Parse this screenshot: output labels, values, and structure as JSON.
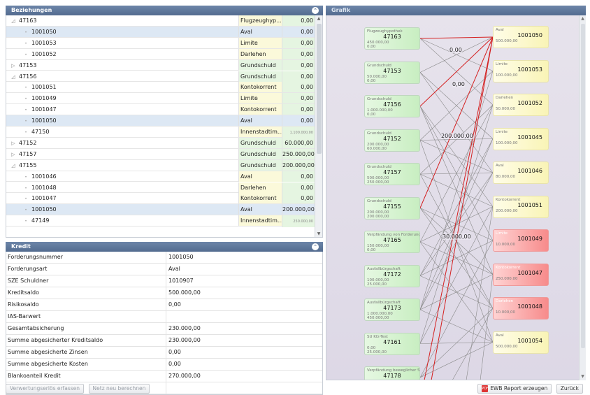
{
  "beziehungen": {
    "title": "Beziehungen",
    "rows": [
      {
        "level": 0,
        "expand": "open",
        "name": "47163",
        "type": "Flugzeughyp...",
        "value": "0,00",
        "tbg": "y",
        "vbg": "g",
        "selected": false
      },
      {
        "level": 1,
        "name": "1001050",
        "type": "Aval",
        "value": "0,00",
        "selected": true
      },
      {
        "level": 1,
        "name": "1001053",
        "type": "Limite",
        "value": "0,00",
        "tbg": "y",
        "vbg": "g",
        "selected": false
      },
      {
        "level": 1,
        "name": "1001052",
        "type": "Darlehen",
        "value": "0,00",
        "tbg": "y",
        "vbg": "g",
        "selected": false
      },
      {
        "level": 0,
        "expand": "closed",
        "name": "47153",
        "type": "Grundschuld",
        "value": "0,00",
        "tbg": "g",
        "vbg": "g",
        "selected": false
      },
      {
        "level": 0,
        "expand": "open",
        "name": "47156",
        "type": "Grundschuld",
        "value": "0,00",
        "tbg": "g",
        "vbg": "g",
        "selected": false
      },
      {
        "level": 1,
        "name": "1001051",
        "type": "Kontokorrent",
        "value": "0,00",
        "tbg": "y",
        "vbg": "g",
        "selected": false
      },
      {
        "level": 1,
        "name": "1001049",
        "type": "Limite",
        "value": "0,00",
        "tbg": "y",
        "vbg": "g",
        "selected": false
      },
      {
        "level": 1,
        "name": "1001047",
        "type": "Kontokorrent",
        "value": "0,00",
        "tbg": "y",
        "vbg": "g",
        "selected": false
      },
      {
        "level": 1,
        "name": "1001050",
        "type": "Aval",
        "value": "0,00",
        "selected": true
      },
      {
        "level": 1,
        "name": "47150",
        "type": "Innenstadtim...",
        "value": "1.100.000,00",
        "small": true,
        "tbg": "y",
        "vbg": "g",
        "selected": false
      },
      {
        "level": 0,
        "expand": "closed",
        "name": "47152",
        "type": "Grundschuld",
        "value": "60.000,00",
        "tbg": "g",
        "vbg": "g",
        "selected": false
      },
      {
        "level": 0,
        "expand": "closed",
        "name": "47157",
        "type": "Grundschuld",
        "value": "250.000,00",
        "tbg": "g",
        "vbg": "g",
        "selected": false
      },
      {
        "level": 0,
        "expand": "open",
        "name": "47155",
        "type": "Grundschuld",
        "value": "200.000,00",
        "tbg": "g",
        "vbg": "g",
        "selected": false
      },
      {
        "level": 1,
        "name": "1001046",
        "type": "Aval",
        "value": "0,00",
        "tbg": "y",
        "vbg": "g",
        "selected": false
      },
      {
        "level": 1,
        "name": "1001048",
        "type": "Darlehen",
        "value": "0,00",
        "tbg": "y",
        "vbg": "g",
        "selected": false
      },
      {
        "level": 1,
        "name": "1001047",
        "type": "Kontokorrent",
        "value": "0,00",
        "tbg": "y",
        "vbg": "g",
        "selected": false
      },
      {
        "level": 1,
        "name": "1001050",
        "type": "Aval",
        "value": "200.000,00",
        "selected": true
      },
      {
        "level": 1,
        "name": "47149",
        "type": "Innenstadtim...",
        "value": "250.000,00",
        "small": true,
        "tbg": "y",
        "vbg": "g",
        "selected": false
      }
    ]
  },
  "kredit": {
    "title": "Kredit",
    "fields": [
      {
        "label": "Forderungsnummer",
        "value": "1001050"
      },
      {
        "label": "Forderungsart",
        "value": "Aval"
      },
      {
        "label": "SZE Schuldner",
        "value": "1010907"
      },
      {
        "label": "Kreditsaldo",
        "value": "500.000,00"
      },
      {
        "label": "Risikosaldo",
        "value": "0,00"
      },
      {
        "label": "IAS-Barwert",
        "value": ""
      },
      {
        "label": "Gesamtabsicherung",
        "value": "230.000,00"
      },
      {
        "label": "Summe abgesicherter Kreditsaldo",
        "value": "230.000,00"
      },
      {
        "label": "Summe abgesicherte Zinsen",
        "value": "0,00"
      },
      {
        "label": "Summe abgesicherte Kosten",
        "value": "0,00"
      },
      {
        "label": "Blankoanteil Kredit",
        "value": "270.000,00"
      },
      {
        "label": "",
        "value": ""
      }
    ]
  },
  "buttons": {
    "verwertung": "Verwertungserlös erfassen",
    "netz": "Netz neu berechnen",
    "report": "EWB Report erzeugen",
    "zurueck": "Zurück"
  },
  "grafik": {
    "title": "Grafik",
    "sources": [
      {
        "type": "Flugzeughypothek",
        "id": "47163",
        "v1": "450.000,00",
        "v2": "0,00"
      },
      {
        "type": "Grundschuld",
        "id": "47153",
        "v1": "50.000,00",
        "v2": "0,00"
      },
      {
        "type": "Grundschuld",
        "id": "47156",
        "v1": "1.000.000,00",
        "v2": "0,00"
      },
      {
        "type": "Grundschuld",
        "id": "47152",
        "v1": "200.000,00",
        "v2": "60.000,00"
      },
      {
        "type": "Grundschuld",
        "id": "47157",
        "v1": "500.000,00",
        "v2": "250.000,00"
      },
      {
        "type": "Grundschuld",
        "id": "47155",
        "v1": "200.000,00",
        "v2": "200.000,00"
      },
      {
        "type": "Verpfändung von Forderungen",
        "id": "47165",
        "v1": "150.000,00",
        "v2": "0,00"
      },
      {
        "type": "Ausfallbürgschaft",
        "id": "47172",
        "v1": "100.000,00",
        "v2": "25.000,00"
      },
      {
        "type": "Ausfallbürgschaft",
        "id": "47173",
        "v1": "1.000.000,00",
        "v2": "450.000,00"
      },
      {
        "type": "SÜ Kfz-Test",
        "id": "47161",
        "v1": "0,00",
        "v2": "25.000,00"
      },
      {
        "type": "Verpfändung beweglicher Sachen",
        "id": "47178",
        "v1": "",
        "v2": ""
      }
    ],
    "targets": [
      {
        "type": "Aval",
        "id": "1001050",
        "v1": "500.000,00",
        "color": "yellow"
      },
      {
        "type": "Limite",
        "id": "1001053",
        "v1": "100.000,00",
        "color": "yellow"
      },
      {
        "type": "Darlehen",
        "id": "1001052",
        "v1": "50.000,00",
        "color": "yellow"
      },
      {
        "type": "Limite",
        "id": "1001045",
        "v1": "100.000,00",
        "color": "yellow"
      },
      {
        "type": "Aval",
        "id": "1001046",
        "v1": "80.000,00",
        "color": "yellow"
      },
      {
        "type": "Kontokorrent",
        "id": "1001051",
        "v1": "200.000,00",
        "color": "yellow"
      },
      {
        "type": "Limite",
        "id": "1001049",
        "v1": "10.000,00",
        "color": "red"
      },
      {
        "type": "Kontokorrent",
        "id": "1001047",
        "v1": "250.000,00",
        "color": "red"
      },
      {
        "type": "Darlehen",
        "id": "1001048",
        "v1": "10.000,00",
        "color": "red"
      },
      {
        "type": "Aval",
        "id": "1001054",
        "v1": "500.000,00",
        "color": "yellow"
      }
    ],
    "edge_labels": [
      "0,00",
      "0,00",
      "200.000,00",
      "30.000,00"
    ],
    "line_color": "#8a8a8a",
    "highlight_color": "#d42020"
  }
}
